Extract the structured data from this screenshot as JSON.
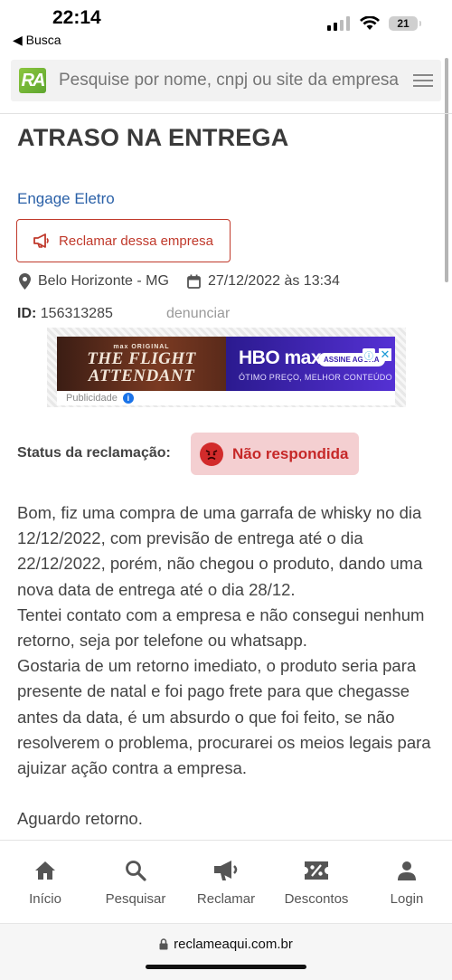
{
  "statusbar": {
    "time": "22:14",
    "back_label": "◀ Busca",
    "battery": "21"
  },
  "header": {
    "logo": "RA",
    "search_placeholder": "Pesquise por nome, cnpj ou site da empresa"
  },
  "complaint": {
    "title": "ATRASO NA ENTREGA",
    "company": "Engage Eletro",
    "complain_button": "Reclamar dessa empresa",
    "location": "Belo Horizonte - MG",
    "datetime": "27/12/2022 às 13:34",
    "id_label": "ID:",
    "id_value": "156313285",
    "report_link": "denunciar",
    "status_label": "Status da reclamação:",
    "status_value": "Não respondida",
    "status_color": "#c62828",
    "body_paragraph_1": "Bom, fiz uma compra de uma garrafa de whisky no dia 12/12/2022, com previsão de entrega até o dia 22/12/2022, porém, não chegou o produto, dando uma nova data de entrega até o dia 28/12.",
    "body_paragraph_2": "Tentei contato com a empresa e não consegui nenhum retorno, seja por telefone ou whatsapp.",
    "body_paragraph_3": "Gostaria de um retorno imediato, o produto seria para presente de natal e foi pago frete para que chegasse antes da data, é um absurdo o que foi feito, se não resolverem o problema, procurarei os meios legais para ajuizar ação contra a empresa.",
    "body_paragraph_4": "Aguardo retorno."
  },
  "ad": {
    "left_small": "max ORIGINAL",
    "left_title_1": "THE FLIGHT",
    "left_title_2": "ATTENDANT",
    "brand": "HBO max",
    "cta": "ASSINE AGORA",
    "tagline": "ÓTIMO PREÇO, MELHOR CONTEÚDO",
    "footer": "Publicidade"
  },
  "nav": {
    "items": [
      {
        "label": "Início",
        "icon": "home-icon"
      },
      {
        "label": "Pesquisar",
        "icon": "search-icon"
      },
      {
        "label": "Reclamar",
        "icon": "megaphone-icon"
      },
      {
        "label": "Descontos",
        "icon": "discount-icon"
      },
      {
        "label": "Login",
        "icon": "user-icon"
      }
    ]
  },
  "browser": {
    "url": "reclameaqui.com.br"
  },
  "colors": {
    "brand_link": "#2b61a8",
    "danger": "#c0392b",
    "status_bg": "#f4cfd1"
  }
}
